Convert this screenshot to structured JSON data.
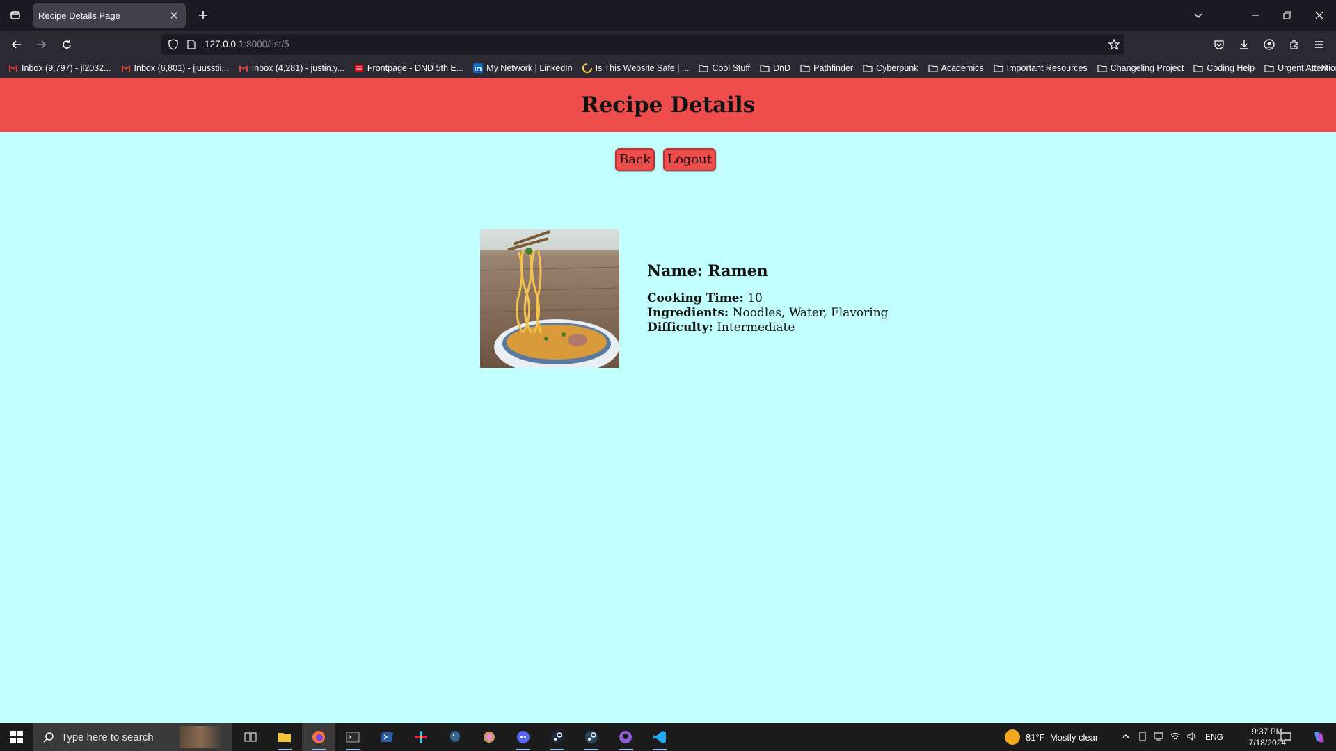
{
  "browser": {
    "tab_title": "Recipe Details Page",
    "url_host": "127.0.0.1",
    "url_path": ":8000/list/5",
    "bookmarks": [
      {
        "label": "Inbox (9,797) - jl2032...",
        "icon": "gmail-icon"
      },
      {
        "label": "Inbox (6,801) - jjuusstii...",
        "icon": "gmail-icon"
      },
      {
        "label": "Inbox (4,281) - justin.y...",
        "icon": "gmail-icon"
      },
      {
        "label": "Frontpage - DND 5th E...",
        "icon": "dnd-icon"
      },
      {
        "label": "My Network | LinkedIn",
        "icon": "linkedin-icon"
      },
      {
        "label": "Is This Website Safe | ...",
        "icon": "loading-icon"
      },
      {
        "label": "Cool Stuff",
        "icon": "folder-icon"
      },
      {
        "label": "DnD",
        "icon": "folder-icon"
      },
      {
        "label": "Pathfinder",
        "icon": "folder-icon"
      },
      {
        "label": "Cyberpunk",
        "icon": "folder-icon"
      },
      {
        "label": "Academics",
        "icon": "folder-icon"
      },
      {
        "label": "Important Resources",
        "icon": "folder-icon"
      },
      {
        "label": "Changeling Project",
        "icon": "folder-icon"
      },
      {
        "label": "Coding Help",
        "icon": "folder-icon"
      },
      {
        "label": "Urgent Attention",
        "icon": "folder-icon"
      }
    ]
  },
  "page": {
    "header_title": "Recipe Details",
    "back_label": "Back",
    "logout_label": "Logout",
    "recipe": {
      "name_prefix": "Name: ",
      "name": "Ramen",
      "cooking_time_label": "Cooking Time:",
      "cooking_time": " 10",
      "ingredients_label": "Ingredients:",
      "ingredients": " Noodles, Water, Flavoring",
      "difficulty_label": "Difficulty:",
      "difficulty": " Intermediate",
      "image": "ramen-photo"
    }
  },
  "taskbar": {
    "search_placeholder": "Type here to search",
    "weather_temp": "81°F",
    "weather_text": "Mostly clear",
    "language": "ENG",
    "time": "9:37 PM",
    "date": "7/18/2024",
    "apps": [
      "task-view-icon",
      "file-explorer-icon",
      "firefox-icon",
      "terminal-icon",
      "powershell-icon",
      "slack-icon",
      "postgres-icon",
      "app-icon",
      "discord-icon",
      "steam-icon",
      "steam-alt-icon",
      "github-icon",
      "vscode-icon"
    ]
  },
  "colors": {
    "header": "#ef4d4c",
    "background": "#c2ffff"
  }
}
